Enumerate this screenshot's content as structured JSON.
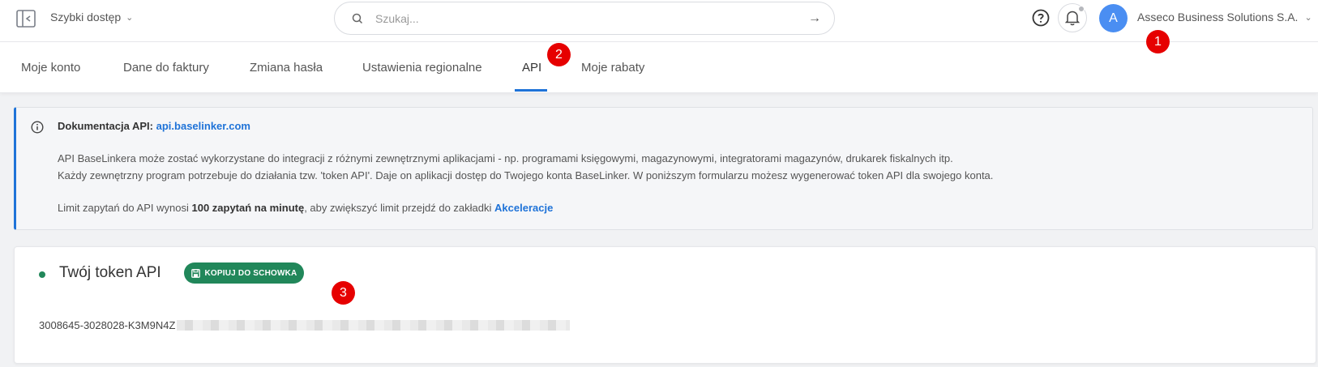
{
  "header": {
    "quick_access_label": "Szybki dostęp",
    "search_placeholder": "Szukaj...",
    "avatar_letter": "A",
    "account_name": "Asseco Business Solutions S.A."
  },
  "tabs": [
    {
      "label": "Moje konto"
    },
    {
      "label": "Dane do faktury"
    },
    {
      "label": "Zmiana hasła"
    },
    {
      "label": "Ustawienia regionalne"
    },
    {
      "label": "API",
      "active": true
    },
    {
      "label": "Moje rabaty"
    }
  ],
  "markers": [
    "1",
    "2",
    "3"
  ],
  "info": {
    "doc_label": "Dokumentacja API:",
    "doc_link": "api.baselinker.com",
    "line1": "API BaseLinkera może zostać wykorzystane do integracji z różnymi zewnętrznymi aplikacjami - np. programami księgowymi, magazynowymi, integratorami magazynów, drukarek fiskalnych itp.",
    "line2": "Każdy zewnętrzny program potrzebuje do działania tzw. 'token API'. Daje on aplikacji dostęp do Twojego konta BaseLinker. W poniższym formularzu możesz wygenerować token API dla swojego konta.",
    "limit_prefix": "Limit zapytań do API wynosi",
    "limit_value": "100 zapytań na minutę",
    "limit_middle": ", aby zwiększyć limit przejdź do zakładki",
    "limit_link": "Akceleracje"
  },
  "token_card": {
    "title": "Twój token API",
    "copy_button": "KOPIUJ DO SCHOWKA",
    "token_visible": "3008645-3028028-K3M9N4Z"
  },
  "colors": {
    "accent_blue": "#1f73d8",
    "green": "#21875a",
    "marker_red": "#e60000",
    "avatar_blue": "#4a8ef2"
  }
}
